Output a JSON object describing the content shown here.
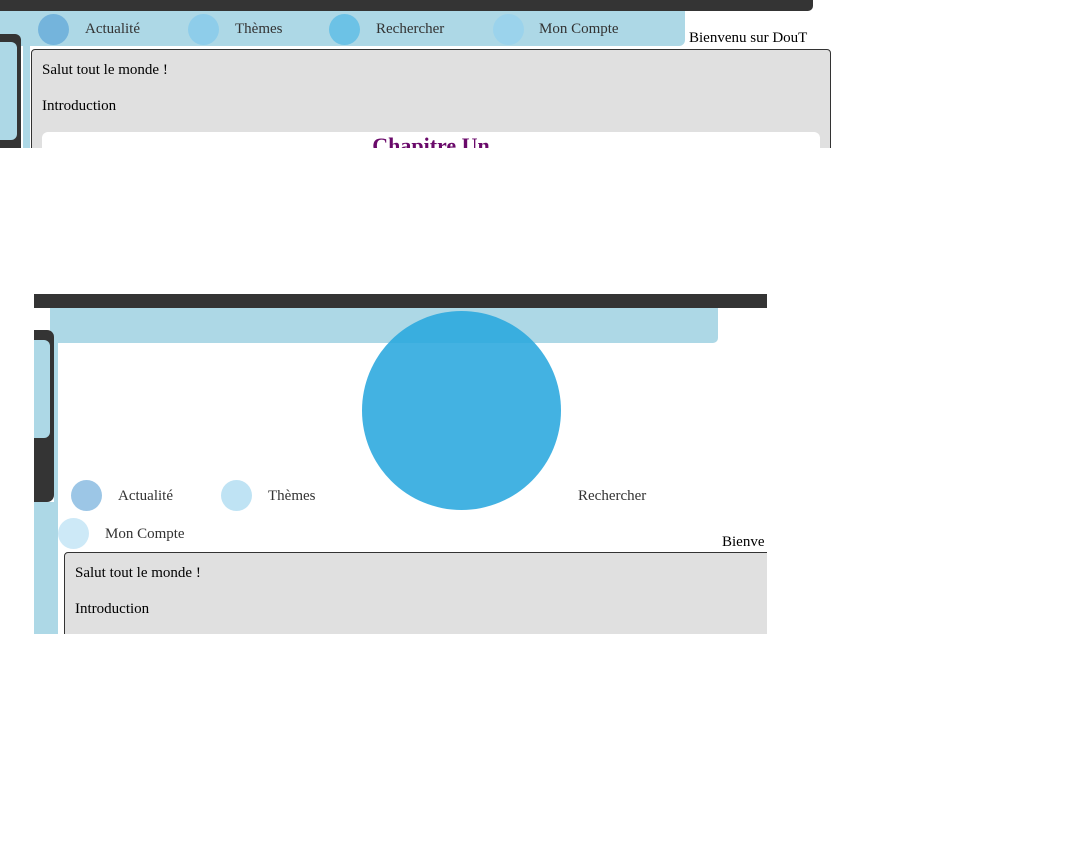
{
  "colors": {
    "dark_bar": "#343434",
    "nav_bg": "#add8e6",
    "content_bg": "#e0e0e0",
    "chapter_title": "#6a0a6a",
    "accent_circle": "#29a7de"
  },
  "frame1": {
    "nav": [
      {
        "label": "Actualité",
        "icon": "circle-icon"
      },
      {
        "label": "Thèmes",
        "icon": "circle-icon"
      },
      {
        "label": "Rechercher",
        "icon": "circle-icon"
      },
      {
        "label": "Mon Compte",
        "icon": "circle-icon"
      }
    ],
    "welcome": "Bienvenu sur DouT",
    "content": {
      "greeting": "Salut tout le monde !",
      "intro": "Introduction",
      "chapter": "Chapitre Un"
    }
  },
  "frame2": {
    "nav": [
      {
        "label": "Actualité",
        "icon": "circle-icon"
      },
      {
        "label": "Thèmes",
        "icon": "circle-icon"
      },
      {
        "label": "Rechercher",
        "icon": "circle-icon"
      },
      {
        "label": "Mon Compte",
        "icon": "circle-icon"
      }
    ],
    "welcome": "Bienve",
    "content": {
      "greeting": "Salut tout le monde !",
      "intro": "Introduction"
    }
  }
}
